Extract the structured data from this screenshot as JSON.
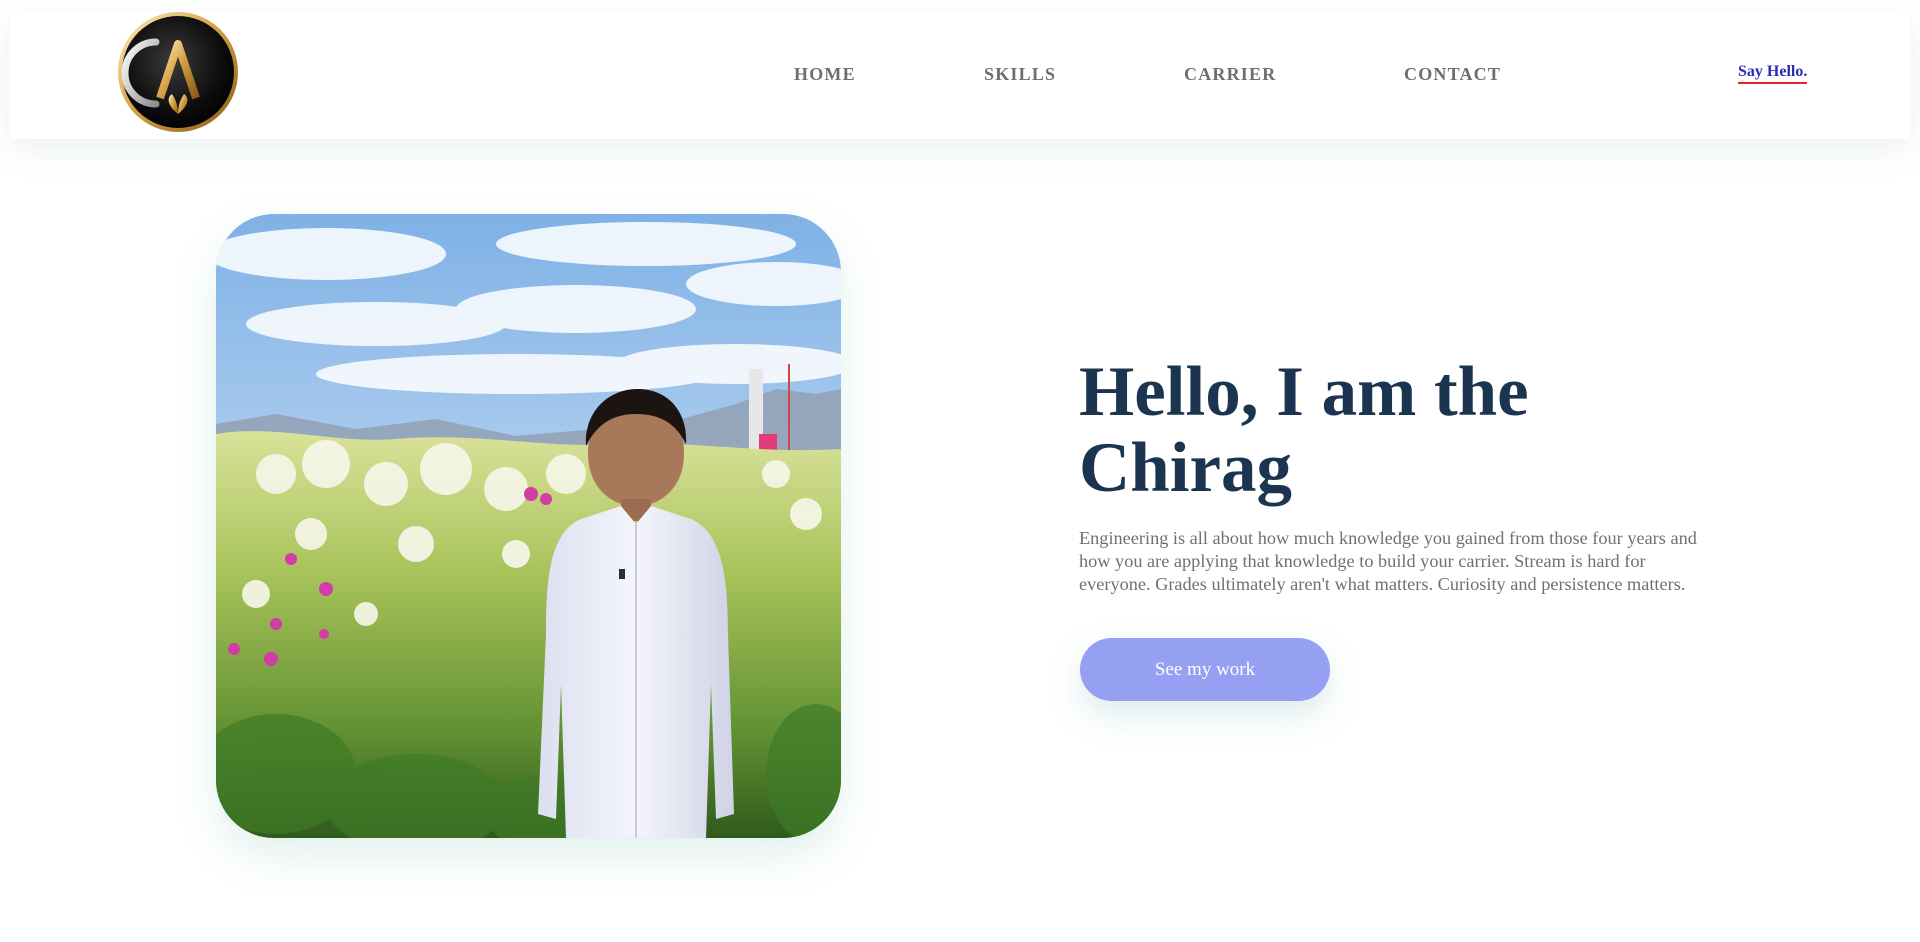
{
  "header": {
    "logo_letter": "A",
    "nav": [
      {
        "label": "HOME"
      },
      {
        "label": "SKILLS"
      },
      {
        "label": "CARRIER"
      },
      {
        "label": "CONTACT"
      }
    ],
    "say_hello_label": "Say Hello."
  },
  "hero": {
    "title": "Hello, I am the Chirag",
    "description": "Engineering is all about how much knowledge you gained from those four years and how you are applying that knowledge to build your carrier. Stream is hard for everyone. Grades ultimately aren't what matters. Curiosity and persistence matters.",
    "cta_label": "See my work"
  },
  "colors": {
    "title": "#1b3550",
    "body_text": "#707070",
    "nav_text": "#6e6e6e",
    "link_text": "#2b2bb8",
    "link_underline": "#e0262b",
    "cta_background": "#95a0f2"
  }
}
